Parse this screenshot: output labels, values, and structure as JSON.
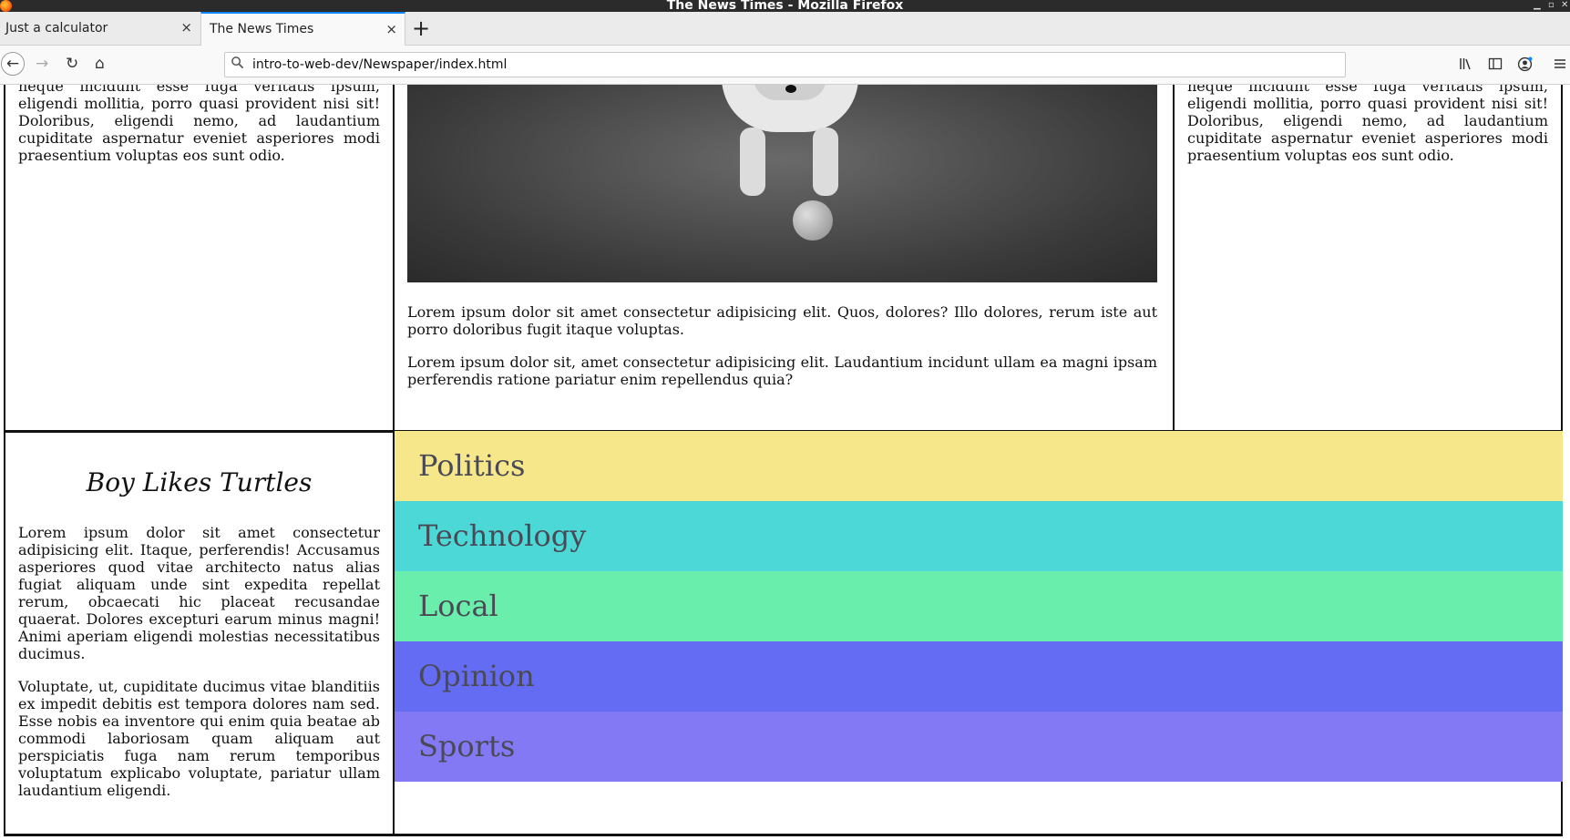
{
  "window": {
    "title": "The News Times - Mozilla Firefox"
  },
  "tabs": [
    {
      "label": "Just a calculator",
      "close": "×"
    },
    {
      "label": "The News Times",
      "close": "×"
    }
  ],
  "newtab": "+",
  "nav": {
    "back": "←",
    "forward": "→",
    "reload": "↻",
    "home": "⌂",
    "url": "intro-to-web-dev/Newspaper/index.html",
    "search_icon": "search-icon",
    "right_icons": [
      "library-icon",
      "sidebar-icon",
      "account-icon",
      "menu-icon"
    ]
  },
  "page": {
    "top_left_text": "neque incidunt esse fuga veritatis ipsum, eligendi mollitia, porro quasi provident nisi sit! Doloribus, eligendi nemo, ad laudantium cupiditate aspernatur eveniet asperiores modi praesentium voluptas eos sunt odio.",
    "top_mid_p1": "Lorem ipsum dolor sit amet consectetur adipisicing elit. Quos, dolores? Illo dolores, rerum iste aut porro doloribus fugit itaque voluptas.",
    "top_mid_p2": "Lorem ipsum dolor sit, amet consectetur adipisicing elit. Laudantium incidunt ullam ea magni ipsam perferendis ratione pariatur enim repellendus quia?",
    "top_right_text": "neque incidunt esse fuga veritatis ipsum, eligendi mollitia, porro quasi provident nisi sit! Doloribus, eligendi nemo, ad laudantium cupiditate aspernatur eveniet asperiores modi praesentium voluptas eos sunt odio.",
    "article_title": "Boy Likes Turtles",
    "article_p1": "Lorem ipsum dolor sit amet consectetur adipisicing elit. Itaque, perferendis! Accusamus asperiores quod vitae architecto natus alias fugiat aliquam unde sint expedita repellat rerum, obcaecati hic placeat recusandae quaerat. Dolores excepturi earum minus magni! Animi aperiam eligendi molestias necessitatibus ducimus.",
    "article_p2": "Voluptate, ut, cupiditate ducimus vitae blanditiis ex impedit debitis est tempora dolores nam sed. Esse nobis ea inventore qui enim quia beatae ab commodi laboriosam quam aliquam aut perspiciatis fuga nam rerum temporibus voluptatum explicabo voluptate, pariatur ullam laudantium eligendi."
  },
  "categories": [
    {
      "label": "Politics",
      "color": "#f7e78b"
    },
    {
      "label": "Technology",
      "color": "#4dd8d8"
    },
    {
      "label": "Local",
      "color": "#6aeeac"
    },
    {
      "label": "Opinion",
      "color": "#636cf3"
    },
    {
      "label": "Sports",
      "color": "#8379f5"
    }
  ]
}
